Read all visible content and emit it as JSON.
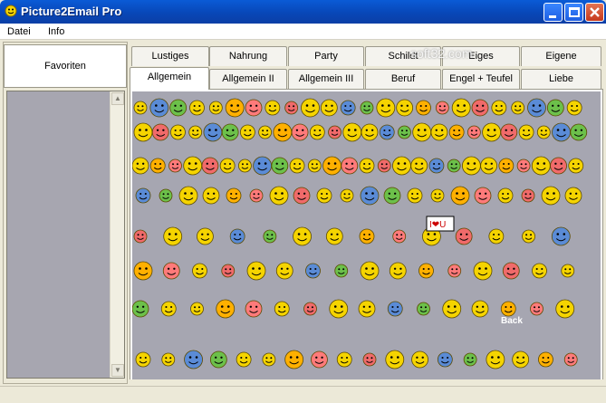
{
  "window": {
    "title": "Picture2Email Pro"
  },
  "menu": [
    "Datei",
    "Info"
  ],
  "favorites_tab": "Favoriten",
  "tabs_row1": [
    "Lustiges",
    "Nahrung",
    "Party",
    "Schildt",
    "Eiges",
    "Eigene"
  ],
  "tabs_row2": [
    "Allgemein",
    "Allgemein II",
    "Allgemein III",
    "Beruf",
    "Engel + Teufel",
    "Liebe"
  ],
  "active_tab": "Allgemein",
  "watermark": "soft32.com",
  "emoji_labels": {
    "sign_love": "I❤U",
    "back": "Back"
  },
  "colors": {
    "title_blue": "#0847b8",
    "panel_gray": "#a6a6b1",
    "emoji_yellow": "#f5d400"
  },
  "icons": {
    "grid": [
      {
        "row": 1,
        "kind": "smiley",
        "count": 24
      },
      {
        "row": 2,
        "kind": "smiley",
        "count": 26
      },
      {
        "row": 3,
        "kind": "smiley",
        "count": 26
      },
      {
        "row": 4,
        "kind": "smiley",
        "count": 20
      },
      {
        "row": 5,
        "kind": "smiley",
        "count": 14
      },
      {
        "row": 6,
        "kind": "smiley",
        "count": 16
      },
      {
        "row": 7,
        "kind": "smiley",
        "count": 16
      },
      {
        "row": 8,
        "kind": "smiley",
        "count": 18
      }
    ]
  }
}
